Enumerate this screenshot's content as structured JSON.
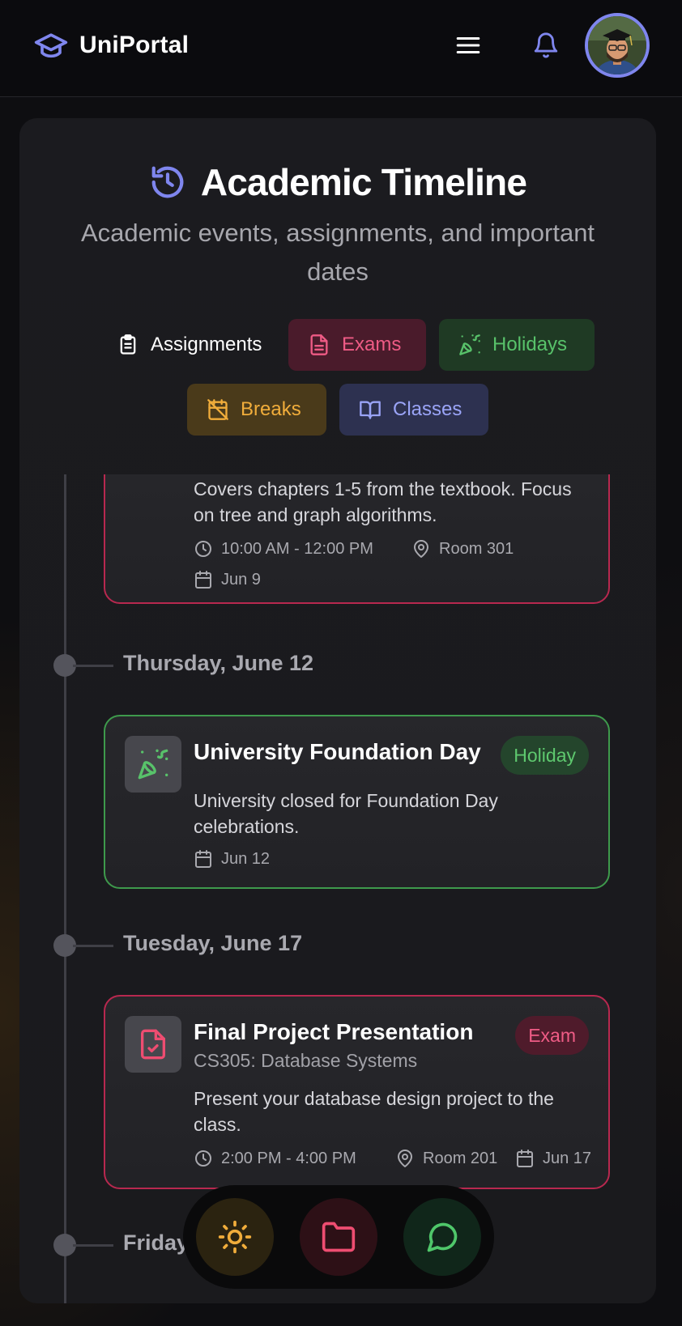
{
  "header": {
    "brand": "UniPortal",
    "icons": [
      "graduation-cap-icon",
      "menu-icon",
      "bell-icon",
      "avatar"
    ]
  },
  "page": {
    "title": "Academic Timeline",
    "subtitle": "Academic events, assignments, and important dates"
  },
  "filters": [
    {
      "label": "Assignments",
      "icon": "clipboard-icon",
      "color": "#ffffff"
    },
    {
      "label": "Exams",
      "icon": "document-icon",
      "color": "#ee5b85"
    },
    {
      "label": "Holidays",
      "icon": "party-popper-icon",
      "color": "#58c26a"
    },
    {
      "label": "Breaks",
      "icon": "calendar-off-icon",
      "color": "#f1ad3b"
    },
    {
      "label": "Classes",
      "icon": "book-open-icon",
      "color": "#9aa4f7"
    }
  ],
  "timeline": {
    "partial_event": {
      "description": "Covers chapters 1-5 from the textbook. Focus on tree and graph algorithms.",
      "time": "10:00 AM - 12:00 PM",
      "location": "Room 301",
      "date": "Jun 9"
    },
    "groups": [
      {
        "date_label": "Thursday, June 12",
        "event": {
          "type": "holiday",
          "title": "University Foundation Day",
          "badge": "Holiday",
          "description": "University closed for Foundation Day celebrations.",
          "date": "Jun 12"
        }
      },
      {
        "date_label": "Tuesday, June 17",
        "event": {
          "type": "exam",
          "title": "Final Project Presentation",
          "course": "CS305: Database Systems",
          "badge": "Exam",
          "description": "Present your database design project to the class.",
          "time": "2:00 PM - 4:00 PM",
          "location": "Room 201",
          "date": "Jun 17"
        }
      },
      {
        "date_label": "Friday"
      }
    ]
  },
  "bottom_nav": [
    {
      "icon": "sun-icon",
      "color": "#f1ad3b"
    },
    {
      "icon": "folder-icon",
      "color": "#ee4d71"
    },
    {
      "icon": "chat-icon",
      "color": "#4fc76a"
    }
  ]
}
